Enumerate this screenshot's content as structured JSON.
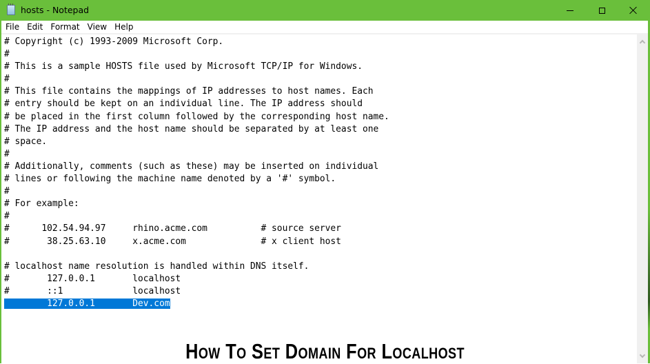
{
  "window": {
    "title": "hosts - Notepad",
    "app_icon": "notepad-icon",
    "controls": {
      "minimize": "minimize-icon",
      "maximize": "maximize-icon",
      "close": "close-icon"
    },
    "accent_color": "#6abf3b"
  },
  "menu": {
    "items": [
      {
        "label": "File"
      },
      {
        "label": "Edit"
      },
      {
        "label": "Format"
      },
      {
        "label": "View"
      },
      {
        "label": "Help"
      }
    ]
  },
  "editor": {
    "selection_color": "#0078d7",
    "lines": [
      "# Copyright (c) 1993-2009 Microsoft Corp.",
      "#",
      "# This is a sample HOSTS file used by Microsoft TCP/IP for Windows.",
      "#",
      "# This file contains the mappings of IP addresses to host names. Each",
      "# entry should be kept on an individual line. The IP address should",
      "# be placed in the first column followed by the corresponding host name.",
      "# The IP address and the host name should be separated by at least one",
      "# space.",
      "#",
      "# Additionally, comments (such as these) may be inserted on individual",
      "# lines or following the machine name denoted by a '#' symbol.",
      "#",
      "# For example:",
      "#",
      "#      102.54.94.97     rhino.acme.com          # source server",
      "#       38.25.63.10     x.acme.com              # x client host",
      "",
      "# localhost name resolution is handled within DNS itself.",
      "#       127.0.0.1       localhost",
      "#       ::1             localhost",
      "        127.0.0.1       Dev.com"
    ],
    "selected_line_index": 21
  },
  "scrollbar": {
    "up_icon": "chevron-up-icon",
    "down_icon": "chevron-down-icon"
  },
  "caption": {
    "text": "How To Set Domain For Localhost"
  }
}
